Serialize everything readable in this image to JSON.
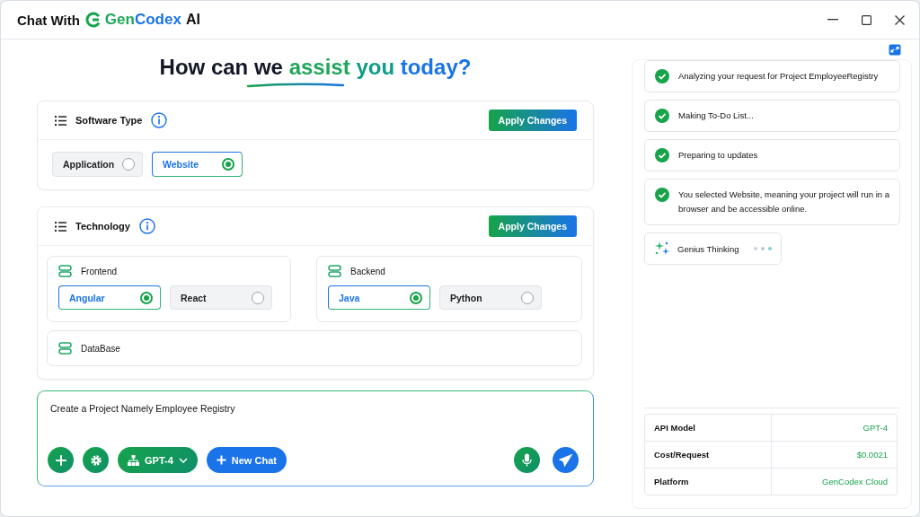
{
  "window": {
    "title_prefix": "Chat With",
    "brand": [
      {
        "text": "Gen",
        "color": "#1fa65a"
      },
      {
        "text": "Codex",
        "color": "#1a73e8"
      }
    ],
    "title_suffix": "AI"
  },
  "heading": [
    {
      "text": "How can we",
      "color": "#111827"
    },
    {
      "text": "assist",
      "color": "#1fa65a"
    },
    {
      "text": "you",
      "color": "#0f9d86"
    },
    {
      "text": "today?",
      "color": "#1a73e8"
    }
  ],
  "software_type": {
    "title": "Software Type",
    "action": "Apply Changes",
    "options": [
      {
        "label": "Application",
        "selected": false
      },
      {
        "label": "Website",
        "selected": true
      }
    ]
  },
  "technology": {
    "title": "Technology",
    "action": "Apply Changes",
    "groups": [
      {
        "name": "Frontend",
        "options": [
          {
            "label": "Angular",
            "selected": true
          },
          {
            "label": "React",
            "selected": false
          }
        ]
      },
      {
        "name": "Backend",
        "options": [
          {
            "label": "Java",
            "selected": true
          },
          {
            "label": "Python",
            "selected": false
          }
        ]
      },
      {
        "name": "DataBase"
      }
    ]
  },
  "prompt": {
    "value": "Create a Project Namely Employee Registry",
    "model": "GPT-4",
    "new_chat": "New Chat"
  },
  "steps": [
    {
      "text": "Analyzing your request for Project EmployeeRegistry",
      "done": true
    },
    {
      "text": "Making To-Do List...",
      "done": true
    },
    {
      "text": "Preparing to updates",
      "done": true
    },
    {
      "text": "You selected Website, meaning your project will run in a browser and be accessible online.",
      "done": true
    }
  ],
  "thinking": {
    "label": "Genius Thinking"
  },
  "info_table": [
    {
      "label": "API Model",
      "value": "GPT-4"
    },
    {
      "label": "Cost/Request",
      "value": "$0.0021"
    },
    {
      "label": "Platform",
      "value": "GenCodex Cloud"
    }
  ]
}
